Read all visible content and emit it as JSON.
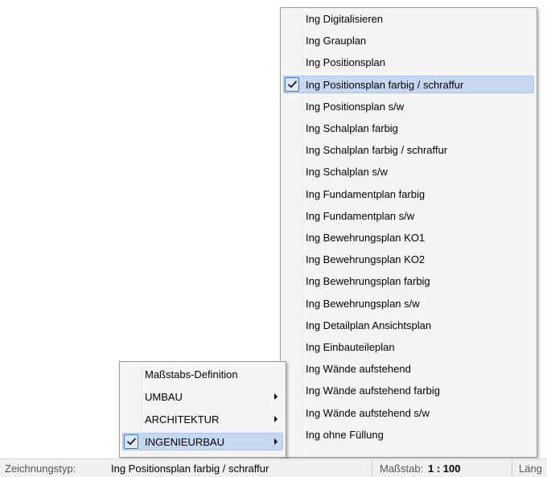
{
  "main_menu": {
    "items": [
      {
        "label": "Maßstabs-Definition",
        "submenu": false,
        "checked": false,
        "active": false
      },
      {
        "label": "UMBAU",
        "submenu": true,
        "checked": false,
        "active": false
      },
      {
        "label": "ARCHITEKTUR",
        "submenu": true,
        "checked": false,
        "active": false
      },
      {
        "label": "INGENIEURBAU",
        "submenu": true,
        "checked": true,
        "active": true
      }
    ]
  },
  "sub_menu": {
    "items": [
      {
        "label": "Ing Digitalisieren"
      },
      {
        "label": "Ing Grauplan"
      },
      {
        "label": "Ing Positionsplan"
      },
      {
        "label": "Ing Positionsplan farbig / schraffur",
        "checked": true,
        "active": true
      },
      {
        "label": "Ing Positionsplan s/w"
      },
      {
        "label": "Ing Schalplan farbig"
      },
      {
        "label": "Ing Schalplan farbig / schraffur"
      },
      {
        "label": "Ing Schalplan s/w"
      },
      {
        "label": "Ing Fundamentplan farbig"
      },
      {
        "label": "Ing Fundamentplan s/w"
      },
      {
        "label": "Ing Bewehrungsplan KO1"
      },
      {
        "label": "Ing Bewehrungsplan KO2"
      },
      {
        "label": "Ing Bewehrungsplan farbig"
      },
      {
        "label": "Ing Bewehrungsplan s/w"
      },
      {
        "label": "Ing Detailplan Ansichtsplan"
      },
      {
        "label": "Ing Einbauteileplan"
      },
      {
        "label": "Ing Wände aufstehend"
      },
      {
        "label": "Ing Wände aufstehend farbig"
      },
      {
        "label": "Ing Wände aufstehend  s/w"
      },
      {
        "label": "Ing ohne Füllung"
      }
    ]
  },
  "statusbar": {
    "drawing_type_label": "Zeichnungstyp:",
    "drawing_type_value": "Ing Positionsplan farbig / schraffur",
    "scale_label": "Maßstab:",
    "scale_value": "1 : 100",
    "length_label": "Läng"
  },
  "icons": {
    "check": "check-mark-icon",
    "submenu_arrow": "chevron-right-icon"
  },
  "colors": {
    "menu_background": "#f5f5f5",
    "highlight_background": "#c5d8f0",
    "highlight_border": "#a8c4e8",
    "check_border": "#4a73a8",
    "statusbar_background": "#f0f0f0"
  }
}
